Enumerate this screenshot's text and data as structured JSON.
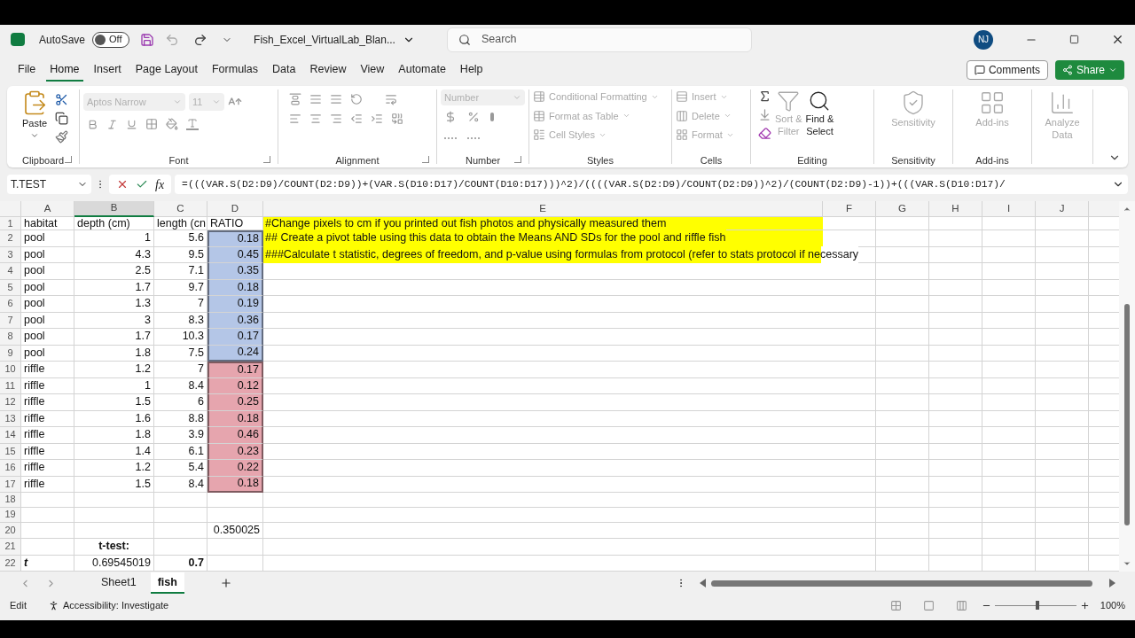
{
  "title_bar": {
    "autosave_label": "AutoSave",
    "autosave": {
      "label": "Off",
      "on": false
    },
    "file_name": "Fish_Excel_VirtualLab_Blan...",
    "search_placeholder": "Search",
    "avatar": "NJ"
  },
  "menu_tabs": [
    {
      "label": "File",
      "selected": false
    },
    {
      "label": "Home",
      "selected": true
    },
    {
      "label": "Insert",
      "selected": false
    },
    {
      "label": "Page Layout",
      "selected": false
    },
    {
      "label": "Formulas",
      "selected": false
    },
    {
      "label": "Data",
      "selected": false
    },
    {
      "label": "Review",
      "selected": false
    },
    {
      "label": "View",
      "selected": false
    },
    {
      "label": "Automate",
      "selected": false
    },
    {
      "label": "Help",
      "selected": false
    }
  ],
  "comments_button": "Comments",
  "share_button": "Share",
  "ribbon": {
    "clipboard": {
      "label": "Clipboard",
      "paste": "Paste"
    },
    "font": {
      "label": "Font",
      "font_name": "Aptos Narrow",
      "font_size": "11"
    },
    "alignment": {
      "label": "Alignment"
    },
    "number": {
      "label": "Number",
      "format": "Number"
    },
    "styles": {
      "label": "Styles",
      "items": [
        {
          "label": "Conditional Formatting",
          "disabled": true
        },
        {
          "label": "Format as Table",
          "disabled": true
        },
        {
          "label": "Cell Styles",
          "disabled": true
        }
      ]
    },
    "cells": {
      "label": "Cells",
      "items": [
        {
          "label": "Insert",
          "disabled": true
        },
        {
          "label": "Delete",
          "disabled": true
        },
        {
          "label": "Format",
          "disabled": true
        }
      ]
    },
    "editing": {
      "label": "Editing",
      "sort": {
        "lines": [
          "Sort &",
          "Filter"
        ],
        "disabled": true
      },
      "find": {
        "lines": [
          "Find &",
          "Select"
        ],
        "disabled": false
      }
    },
    "sensitivity": {
      "label": "Sensitivity",
      "button": {
        "lines": [
          "Sensitivity"
        ],
        "disabled": true
      }
    },
    "addins": {
      "label": "Add-ins",
      "button": {
        "lines": [
          "Add-ins"
        ],
        "disabled": true
      }
    },
    "analyze": {
      "button": {
        "lines": [
          "Analyze",
          "Data"
        ],
        "disabled": true
      }
    }
  },
  "formula_bar": {
    "name_box": "T.TEST",
    "function_label": "fx",
    "formula": "=(((VAR.S(D2:D9)/COUNT(D2:D9))+(VAR.S(D10:D17)/COUNT(D10:D17)))^2)/((((VAR.S(D2:D9)/COUNT(D2:D9))^2)/(COUNT(D2:D9)-1))+(((VAR.S(D10:D17)/"
  },
  "columns": [
    {
      "label": "A",
      "selected": false
    },
    {
      "label": "B",
      "selected": true
    },
    {
      "label": "C",
      "selected": false
    },
    {
      "label": "D",
      "selected": false
    },
    {
      "label": "E",
      "selected": false
    },
    {
      "label": "F",
      "selected": false
    },
    {
      "label": "G",
      "selected": false
    },
    {
      "label": "H",
      "selected": false
    },
    {
      "label": "I",
      "selected": false
    },
    {
      "label": "J",
      "selected": false
    }
  ],
  "rows": [
    {
      "number": "1",
      "kind": "header",
      "cells": {
        "A": "habitat",
        "B": "depth (cm)",
        "C": "length (cn",
        "D": "RATIO"
      },
      "note": {
        "text": "#Change pixels to cm if you printed out fish photos and physically measured them",
        "highlighted": true
      }
    },
    {
      "number": "2",
      "kind": "data",
      "color": "#b4c6e7",
      "cells": {
        "A": "pool",
        "B": "1",
        "C": "5.6",
        "D": "0.18"
      },
      "note": {
        "text": "## Create a pivot table using this data to obtain the Means AND SDs for the pool and riffle fish",
        "highlighted": true
      }
    },
    {
      "number": "3",
      "kind": "data",
      "color": "#b4c6e7",
      "cells": {
        "A": "pool",
        "B": "4.3",
        "C": "9.5",
        "D": "0.45"
      },
      "note": {
        "text": "###Calculate t statistic, degrees of freedom, and p-value using formulas from protocol (refer to stats protocol if necessary",
        "highlighted": true
      }
    },
    {
      "number": "4",
      "kind": "data",
      "color": "#b4c6e7",
      "cells": {
        "A": "pool",
        "B": "2.5",
        "C": "7.1",
        "D": "0.35"
      }
    },
    {
      "number": "5",
      "kind": "data",
      "color": "#b4c6e7",
      "cells": {
        "A": "pool",
        "B": "1.7",
        "C": "9.7",
        "D": "0.18"
      }
    },
    {
      "number": "6",
      "kind": "data",
      "color": "#b4c6e7",
      "cells": {
        "A": "pool",
        "B": "1.3",
        "C": "7",
        "D": "0.19"
      }
    },
    {
      "number": "7",
      "kind": "data",
      "color": "#b4c6e7",
      "cells": {
        "A": "pool",
        "B": "3",
        "C": "8.3",
        "D": "0.36"
      }
    },
    {
      "number": "8",
      "kind": "data",
      "color": "#b4c6e7",
      "cells": {
        "A": "pool",
        "B": "1.7",
        "C": "10.3",
        "D": "0.17"
      }
    },
    {
      "number": "9",
      "kind": "data",
      "color": "#b4c6e7",
      "cells": {
        "A": "pool",
        "B": "1.8",
        "C": "7.5",
        "D": "0.24"
      }
    },
    {
      "number": "10",
      "kind": "data",
      "color": "#e6a5ae",
      "cells": {
        "A": "riffle",
        "B": "1.2",
        "C": "7",
        "D": "0.17"
      }
    },
    {
      "number": "11",
      "kind": "data",
      "color": "#e6a5ae",
      "cells": {
        "A": "riffle",
        "B": "1",
        "C": "8.4",
        "D": "0.12"
      }
    },
    {
      "number": "12",
      "kind": "data",
      "color": "#e6a5ae",
      "cells": {
        "A": "riffle",
        "B": "1.5",
        "C": "6",
        "D": "0.25"
      }
    },
    {
      "number": "13",
      "kind": "data",
      "color": "#e6a5ae",
      "cells": {
        "A": "riffle",
        "B": "1.6",
        "C": "8.8",
        "D": "0.18"
      }
    },
    {
      "number": "14",
      "kind": "data",
      "color": "#e6a5ae",
      "cells": {
        "A": "riffle",
        "B": "1.8",
        "C": "3.9",
        "D": "0.46"
      }
    },
    {
      "number": "15",
      "kind": "data",
      "color": "#e6a5ae",
      "cells": {
        "A": "riffle",
        "B": "1.4",
        "C": "6.1",
        "D": "0.23"
      }
    },
    {
      "number": "16",
      "kind": "data",
      "color": "#e6a5ae",
      "cells": {
        "A": "riffle",
        "B": "1.2",
        "C": "5.4",
        "D": "0.22"
      }
    },
    {
      "number": "17",
      "kind": "data",
      "color": "#e6a5ae",
      "cells": {
        "A": "riffle",
        "B": "1.5",
        "C": "8.4",
        "D": "0.18"
      }
    },
    {
      "number": "18",
      "kind": "blank",
      "cells": {}
    },
    {
      "number": "19",
      "kind": "blank",
      "cells": {}
    },
    {
      "number": "20",
      "kind": "value",
      "cells": {
        "D": "0.350025"
      }
    },
    {
      "number": "21",
      "kind": "label",
      "cells": {
        "B": "t-test:"
      }
    },
    {
      "number": "22",
      "kind": "result",
      "cells": {
        "A": "t",
        "B": "0.69545019",
        "C": "0.7"
      }
    }
  ],
  "sheet_tabs": [
    {
      "label": "Sheet1",
      "selected": false
    },
    {
      "label": "fish",
      "selected": true
    }
  ],
  "status_bar": {
    "mode": "Edit",
    "accessibility": "Accessibility: Investigate",
    "zoom": "100%",
    "zoom_slider": {
      "level": 0.5
    }
  }
}
